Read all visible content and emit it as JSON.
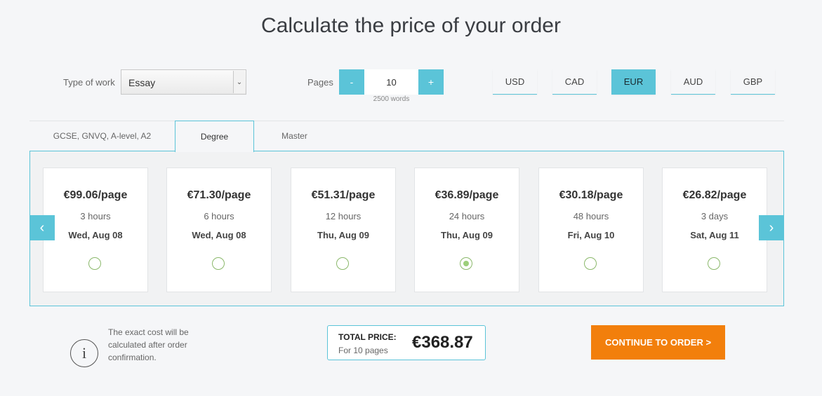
{
  "title": "Calculate the price of your order",
  "type_of_work": {
    "label": "Type of work",
    "value": "Essay"
  },
  "pages": {
    "label": "Pages",
    "minus": "-",
    "plus": "+",
    "value": "10",
    "words": "2500 words"
  },
  "currencies": [
    {
      "label": "USD",
      "active": false
    },
    {
      "label": "CAD",
      "active": false
    },
    {
      "label": "EUR",
      "active": true
    },
    {
      "label": "AUD",
      "active": false
    },
    {
      "label": "GBP",
      "active": false
    }
  ],
  "tabs": [
    {
      "label": "GCSE, GNVQ, A-level, A2",
      "active": false
    },
    {
      "label": "Degree",
      "active": true
    },
    {
      "label": "Master",
      "active": false
    }
  ],
  "options": [
    {
      "price": "€99.06/page",
      "duration": "3 hours",
      "date": "Wed, Aug 08",
      "selected": false
    },
    {
      "price": "€71.30/page",
      "duration": "6 hours",
      "date": "Wed, Aug 08",
      "selected": false
    },
    {
      "price": "€51.31/page",
      "duration": "12 hours",
      "date": "Thu, Aug 09",
      "selected": false
    },
    {
      "price": "€36.89/page",
      "duration": "24 hours",
      "date": "Thu, Aug 09",
      "selected": true
    },
    {
      "price": "€30.18/page",
      "duration": "48 hours",
      "date": "Fri, Aug 10",
      "selected": false
    },
    {
      "price": "€26.82/page",
      "duration": "3 days",
      "date": "Sat, Aug 11",
      "selected": false
    }
  ],
  "nav": {
    "prev": "‹",
    "next": "›"
  },
  "info": {
    "icon": "i",
    "text": "The exact cost will be calculated after order confirmation."
  },
  "total": {
    "label": "TOTAL PRICE:",
    "sub": "For 10 pages",
    "value": "€368.87"
  },
  "continue_label": "CONTINUE TO ORDER >",
  "colors": {
    "accent": "#5bc4d8",
    "cta": "#f27f0c",
    "radio": "#9ccf7a"
  }
}
